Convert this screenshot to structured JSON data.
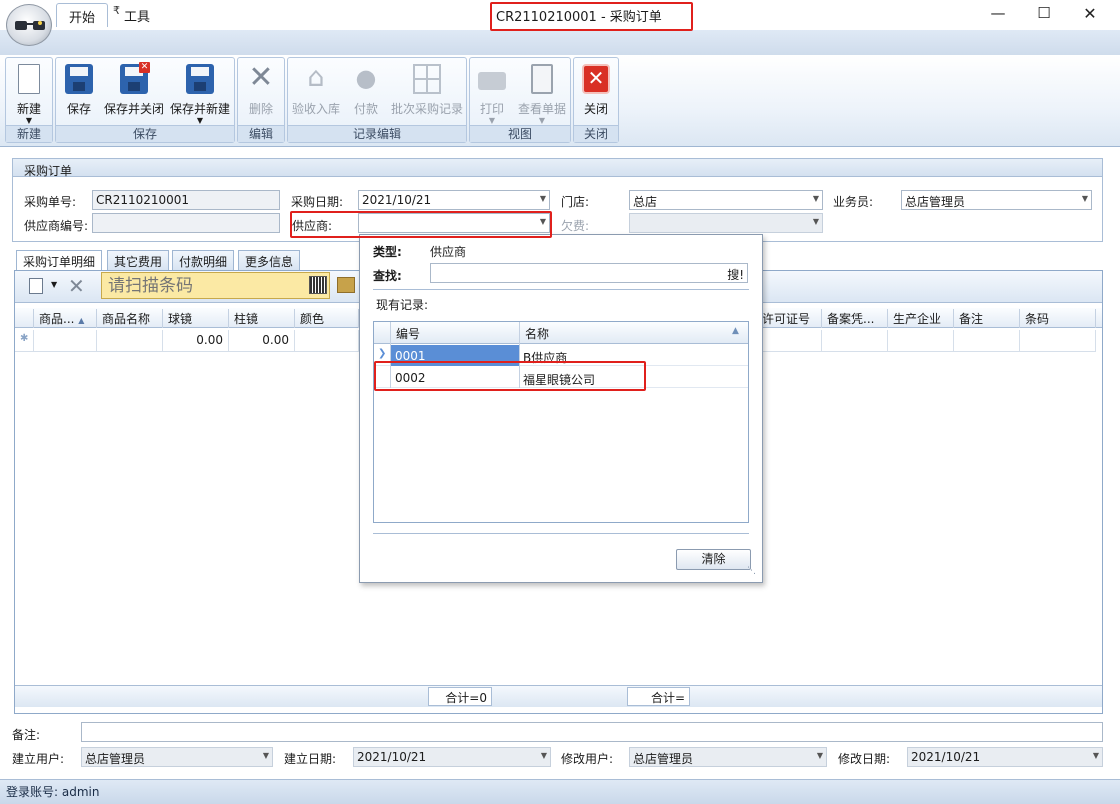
{
  "window": {
    "title": "CR2110210001 - 采购订单",
    "quick_more": "₹"
  },
  "ribbon": {
    "tabs": [
      "开始",
      "工具"
    ],
    "groups": {
      "new": {
        "label": "新建",
        "buttons": {
          "new": "新建"
        }
      },
      "save": {
        "label": "保存",
        "buttons": {
          "save": "保存",
          "save_close": "保存并关闭",
          "save_new": "保存并新建"
        }
      },
      "edit": {
        "label": "编辑",
        "buttons": {
          "delete": "删除"
        }
      },
      "record": {
        "label": "记录编辑",
        "buttons": {
          "receive": "验收入库",
          "pay": "付款",
          "batch": "批次采购记录"
        }
      },
      "view": {
        "label": "视图",
        "buttons": {
          "print": "打印",
          "view_doc": "查看单据"
        }
      },
      "close": {
        "label": "关闭",
        "buttons": {
          "close": "关闭"
        }
      }
    }
  },
  "form": {
    "title": "采购订单",
    "order_no_label": "采购单号:",
    "order_no": "CR2110210001",
    "date_label": "采购日期:",
    "date": "2021/10/21",
    "store_label": "门店:",
    "store": "总店",
    "salesman_label": "业务员:",
    "salesman": "总店管理员",
    "supplier_code_label": "供应商编号:",
    "supplier_code": "",
    "supplier_label": "供应商:",
    "supplier": "",
    "owed_label": "欠费:",
    "owed": ""
  },
  "detail_tabs": [
    "采购订单明细",
    "其它费用",
    "付款明细",
    "更多信息"
  ],
  "toolbar": {
    "scan_placeholder": "请扫描条码"
  },
  "grid": {
    "columns_left": [
      "商品...",
      "商品名称",
      "球镜",
      "柱镜",
      "颜色"
    ],
    "columns_right": [
      "许可证号",
      "备案凭...",
      "生产企业",
      "备注",
      "条码"
    ],
    "row": {
      "sph": "0.00",
      "cyl": "0.00"
    },
    "sum1": "合计=0",
    "sum2": "合计="
  },
  "popup": {
    "type_label": "类型:",
    "type_value": "供应商",
    "search_label": "查找:",
    "search_value": "",
    "search_button": "搜!",
    "records_label": "现有记录:",
    "columns": [
      "编号",
      "名称"
    ],
    "rows": [
      {
        "code": "0001",
        "name": "B供应商"
      },
      {
        "code": "0002",
        "name": "福星眼镜公司"
      }
    ],
    "clear_button": "清除"
  },
  "bottom": {
    "remark_label": "备注:",
    "remark": "",
    "created_user_label": "建立用户:",
    "created_user": "总店管理员",
    "created_date_label": "建立日期:",
    "created_date": "2021/10/21",
    "modified_user_label": "修改用户:",
    "modified_user": "总店管理员",
    "modified_date_label": "修改日期:",
    "modified_date": "2021/10/21"
  },
  "status": {
    "login": "登录账号: admin"
  },
  "colors": {
    "highlight": "#e0201c",
    "ribbon_bg": "#dce7f3",
    "scan_bg": "#fbe9a4",
    "selected_row": "#5a8ed6"
  }
}
